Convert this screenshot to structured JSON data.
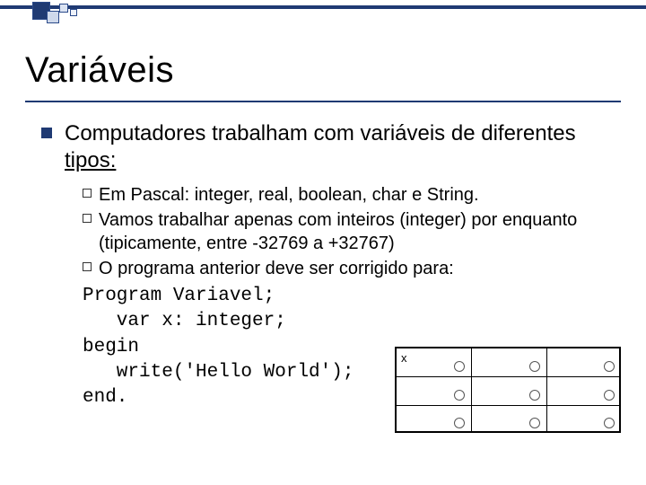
{
  "title": "Variáveis",
  "intro": {
    "before": "Computadores trabalham com variáveis de diferentes ",
    "underlined": "tipos:"
  },
  "sub": {
    "a": "Em Pascal: integer, real, boolean, char e String.",
    "b": "Vamos trabalhar apenas com inteiros (integer) por enquanto (tipicamente, entre -32769 a +32767)",
    "c": "O programa anterior deve ser corrigido para:"
  },
  "code": {
    "l1": "Program Variavel;",
    "l2": "   var x: integer;",
    "l3": "begin",
    "l4": "   write('Hello World');",
    "l5": "end."
  },
  "table": {
    "first_cell_label": "x"
  }
}
